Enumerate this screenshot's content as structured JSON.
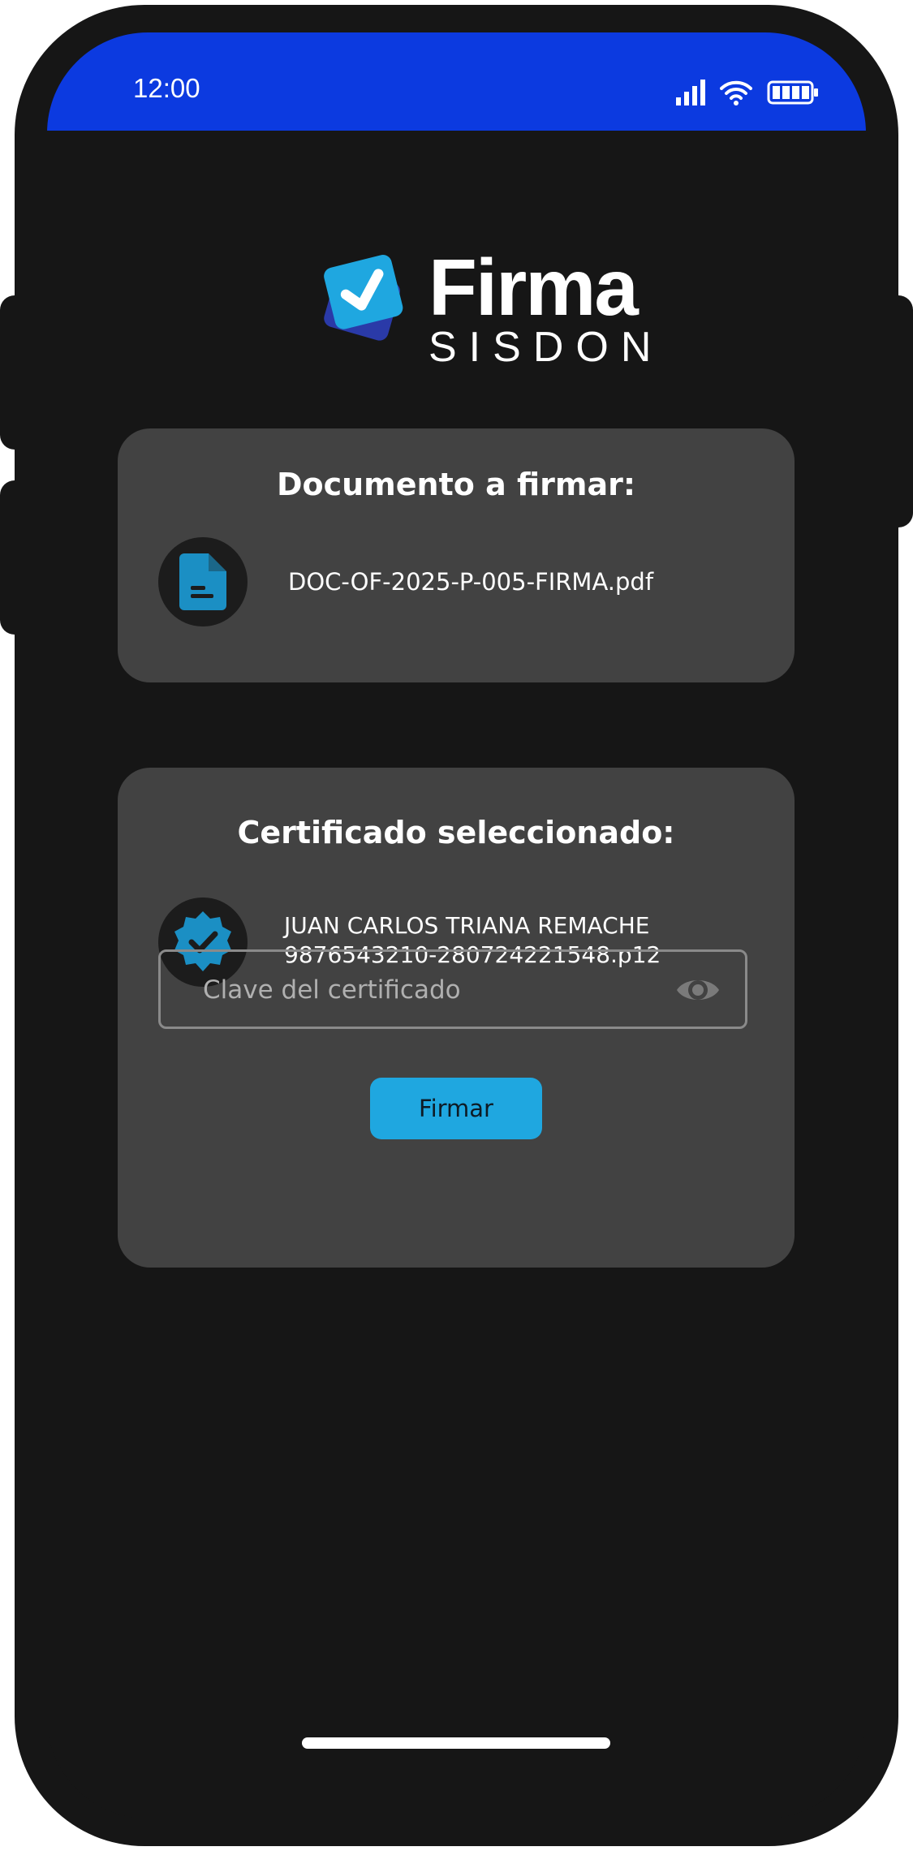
{
  "status_bar": {
    "time": "12:00",
    "icons": [
      "signal-icon",
      "wifi-icon",
      "battery-icon"
    ],
    "color": "#0c3ae0"
  },
  "logo": {
    "word": "Firma",
    "sub": "SISDON"
  },
  "document_card": {
    "title": "Documento a firmar:",
    "icon": "document-icon",
    "file_name": "DOC-OF-2025-P-005-FIRMA.pdf"
  },
  "certificate_card": {
    "title": "Certificado seleccionado:",
    "icon": "verified-badge-icon",
    "holder_name": "JUAN CARLOS TRIANA REMACHE",
    "file_name": "9876543210-280724221548.p12",
    "password_placeholder": "Clave del certificado",
    "password_value": "",
    "sign_button": "Firmar"
  },
  "colors": {
    "accent": "#1fa7e0",
    "card": "#424242",
    "background": "#161616"
  }
}
